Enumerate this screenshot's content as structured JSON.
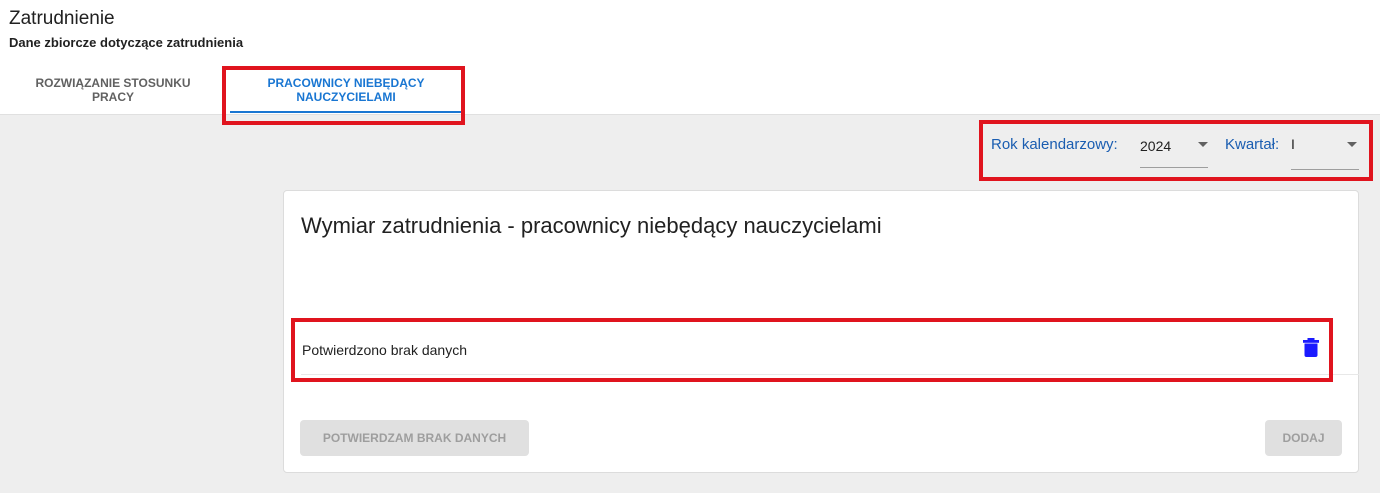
{
  "header": {
    "title": "Zatrudnienie",
    "subtitle": "Dane zbiorcze dotyczące zatrudnienia"
  },
  "tabs": [
    {
      "label_line1": "ROZWIĄZANIE STOSUNKU",
      "label_line2": "PRACY",
      "active": false
    },
    {
      "label_line1": "PRACOWNICY NIEBĘDĄCY",
      "label_line2": "NAUCZYCIELAMI",
      "active": true
    }
  ],
  "filters": {
    "year_label": "Rok kalendarzowy:",
    "year_value": "2024",
    "quarter_label": "Kwartał:",
    "quarter_value": "I"
  },
  "card": {
    "title": "Wymiar zatrudnienia - pracownicy niebędący nauczycielami",
    "row_text": "Potwierdzono brak danych",
    "confirm_button": "POTWIERDZAM BRAK DANYCH",
    "add_button": "DODAJ"
  },
  "colors": {
    "accent": "#1976d2",
    "label_blue": "#1a5db1",
    "highlight": "#e0141e",
    "delete_icon": "#1a1aff"
  }
}
